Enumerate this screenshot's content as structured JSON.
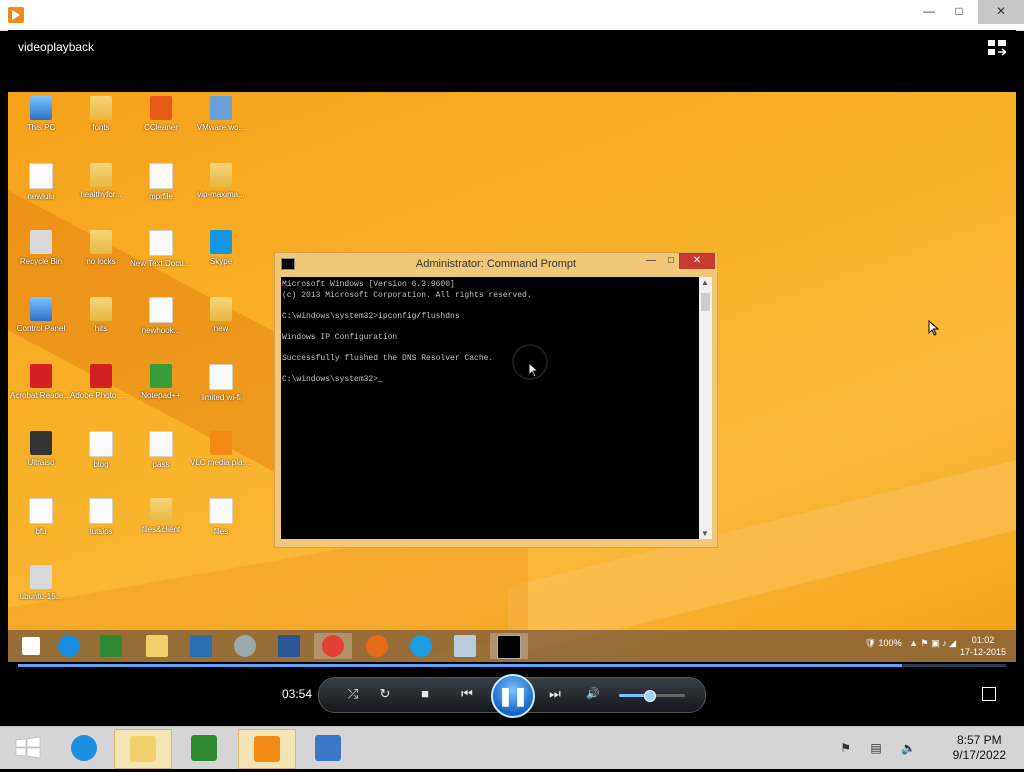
{
  "window": {
    "minimize": "—",
    "maximize": "□",
    "close": "✕"
  },
  "video": {
    "title": "videoplayback"
  },
  "desktop_icons": [
    {
      "label": "This PC",
      "icon": "pc-icon"
    },
    {
      "label": "fonts",
      "icon": "folder-icon"
    },
    {
      "label": "CCleaner",
      "icon": "ccleaner-icon"
    },
    {
      "label": "VMware wo...",
      "icon": "vmware-icon"
    },
    {
      "label": "newlulu",
      "icon": "file-icon"
    },
    {
      "label": "healthyfor...",
      "icon": "folder-icon"
    },
    {
      "label": "mprfile",
      "icon": "file-icon"
    },
    {
      "label": "vip-maxima...",
      "icon": "folder-icon"
    },
    {
      "label": "Recycle Bin",
      "icon": "recycle-bin-icon"
    },
    {
      "label": "no locks",
      "icon": "folder-icon"
    },
    {
      "label": "New Text Document",
      "icon": "file-icon"
    },
    {
      "label": "Skype",
      "icon": "skype-icon"
    },
    {
      "label": "Control Panel",
      "icon": "control-panel-icon"
    },
    {
      "label": "hits",
      "icon": "folder-icon"
    },
    {
      "label": "newhook...",
      "icon": "file-icon"
    },
    {
      "label": "new",
      "icon": "folder-icon"
    },
    {
      "label": "Acrobat Reader XI",
      "icon": "acrobat-icon"
    },
    {
      "label": "Adobe Photo Office",
      "icon": "adobe-icon"
    },
    {
      "label": "Notepad++",
      "icon": "notepad-icon"
    },
    {
      "label": "limited wi-fi",
      "icon": "file-icon"
    },
    {
      "label": "Ultraiso",
      "icon": "ultraiso-icon"
    },
    {
      "label": "blog",
      "icon": "file-icon"
    },
    {
      "label": "pass",
      "icon": "file-icon"
    },
    {
      "label": "VLC media player",
      "icon": "vlc-icon"
    },
    {
      "label": "bfu",
      "icon": "file-icon"
    },
    {
      "label": "tutsips",
      "icon": "file-icon"
    },
    {
      "label": "files&client",
      "icon": "folder-icon"
    },
    {
      "label": "files",
      "icon": "file-icon"
    },
    {
      "label": "ubuntu-15...",
      "icon": "disc-icon"
    }
  ],
  "cmd": {
    "title": "Administrator: Command Prompt",
    "lines": [
      "Microsoft Windows [Version 6.3.9600]",
      "(c) 2013 Microsoft Corporation. All rights reserved.",
      "",
      "C:\\windows\\system32>ipconfig/flushdns",
      "",
      "Windows IP Configuration",
      "",
      "Successfully flushed the DNS Resolver Cache.",
      "",
      "C:\\windows\\system32>_"
    ]
  },
  "remote_taskbar": {
    "battery": "100%",
    "clock_time": "01:02",
    "clock_date": "17-12-2015"
  },
  "player": {
    "elapsed": "03:54",
    "seek_fraction": 0.895,
    "volume_fraction": 0.45,
    "buttons": {
      "shuffle": "⤮",
      "repeat": "↻",
      "stop": "■",
      "previous": "⏮",
      "pause": "❚❚",
      "next": "⏭",
      "mute": "🔊"
    }
  },
  "host_taskbar": {
    "clock_time": "8:57 PM",
    "clock_date": "9/17/2022"
  },
  "colors": {
    "accent": "#1566c6",
    "desktop": "#f8b32a"
  }
}
